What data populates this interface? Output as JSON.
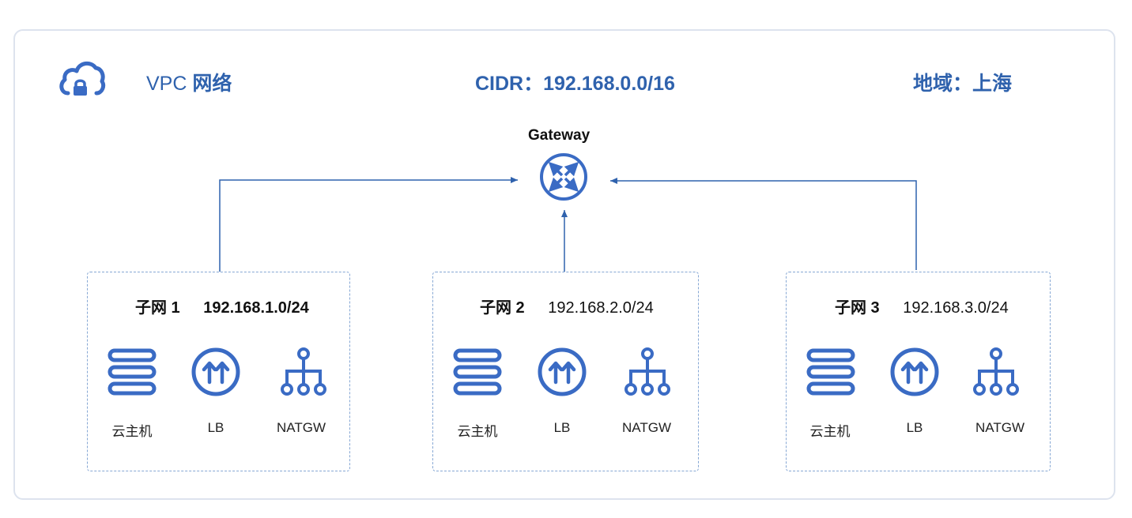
{
  "header": {
    "vpc_prefix": "VPC",
    "vpc_title": "网络",
    "cidr": "CIDR：192.168.0.0/16",
    "region": "地域：上海"
  },
  "gateway": {
    "label": "Gateway",
    "icon": "router-icon"
  },
  "subnets": [
    {
      "name": "子网 1",
      "cidr": "192.168.1.0/24",
      "resources": [
        "云主机",
        "LB",
        "NATGW"
      ]
    },
    {
      "name": "子网 2",
      "cidr": "192.168.2.0/24",
      "resources": [
        "云主机",
        "LB",
        "NATGW"
      ]
    },
    {
      "name": "子网 3",
      "cidr": "192.168.3.0/24",
      "resources": [
        "云主机",
        "LB",
        "NATGW"
      ]
    }
  ],
  "colors": {
    "accent": "#2f62ad",
    "icon": "#3a6bc4",
    "frame": "#dde3ee",
    "dashed_border": "#86a7d4"
  }
}
